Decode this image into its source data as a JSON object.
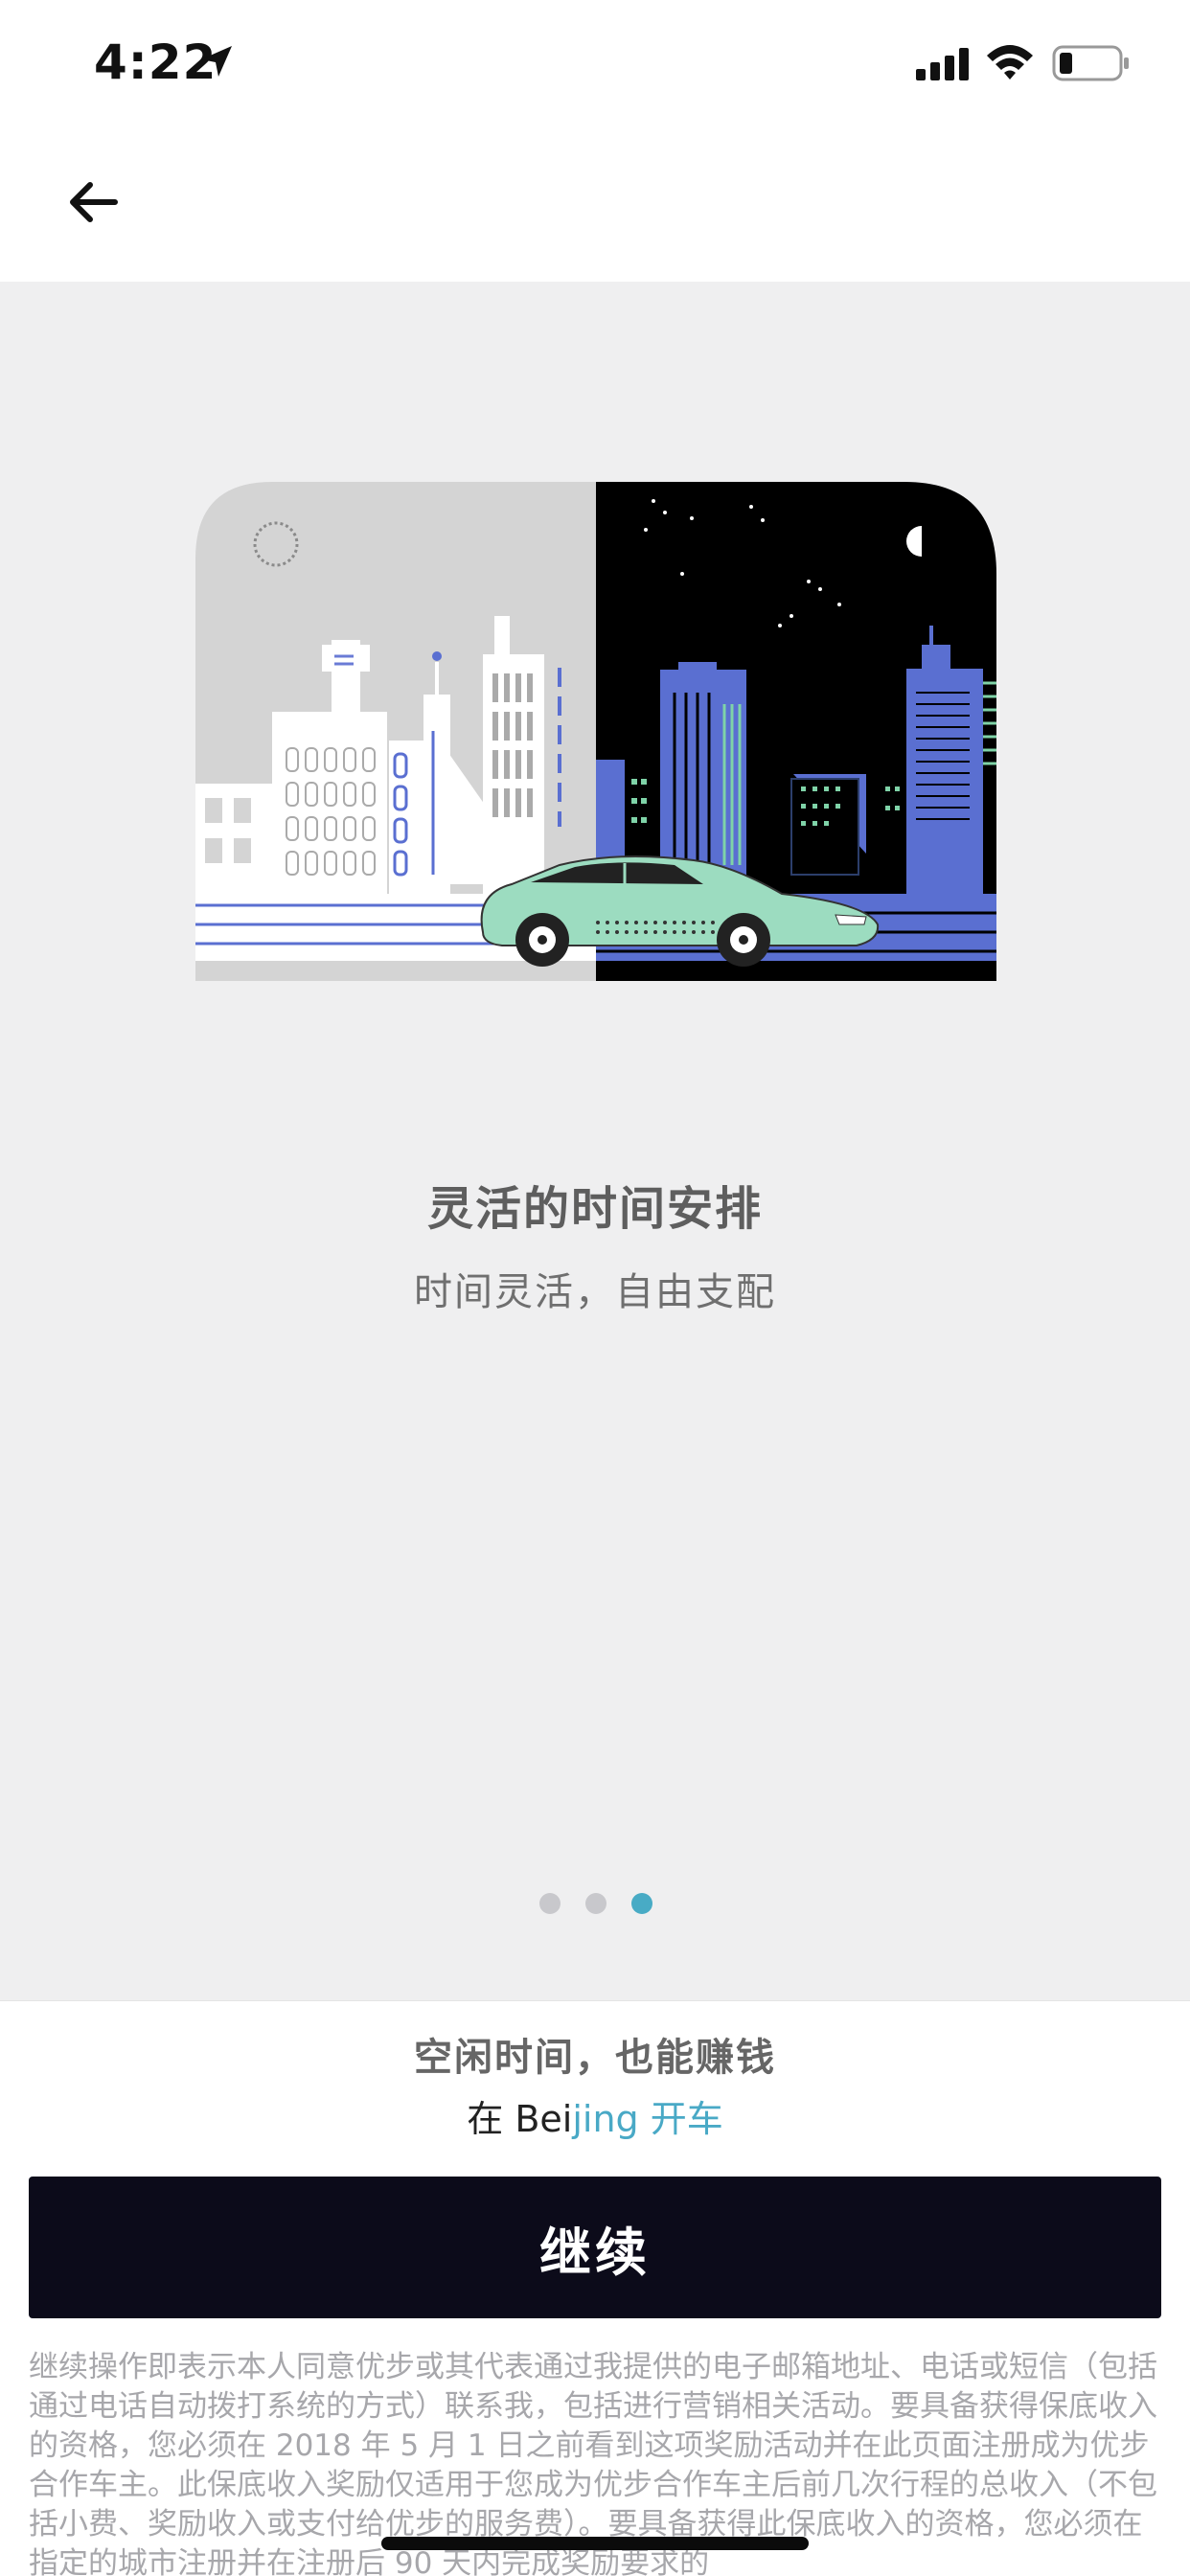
{
  "status_bar": {
    "time": "4:22",
    "icons": [
      "location-arrow-icon",
      "cellular-signal-icon",
      "wifi-icon",
      "battery-low-icon"
    ]
  },
  "nav": {
    "back_icon": "arrow-left-icon"
  },
  "illustration": {
    "subject": "city-day-night-car-illustration",
    "colors": {
      "day_bg": "#d4d4d4",
      "night_bg": "#000000",
      "building_blue": "#5a6fd1",
      "car_mint": "#9cdcc0",
      "accent_green": "#7fd3a8"
    }
  },
  "slide": {
    "title": "灵活的时间安排",
    "subtitle": "时间灵活，自由支配"
  },
  "pagination": {
    "total": 3,
    "active_index": 2,
    "active_color": "#48abc5",
    "inactive_color": "#c8c8cc"
  },
  "bottom": {
    "promo": "空闲时间，也能赚钱",
    "city_prefix": "在 Bei",
    "city_link": "jing 开车",
    "continue_label": "继续",
    "legal_text": "继续操作即表示本人同意优步或其代表通过我提供的电子邮箱地址、电话或短信（包括通过电话自动拨打系统的方式）联系我，包括进行营销相关活动。要具备获得保底收入的资格，您必须在 2018 年 5 月 1 日之前看到这项奖励活动并在此页面注册成为优步合作车主。此保底收入奖励仅适用于您成为优步合作车主后前几次行程的总收入（不包括小费、奖励收入或支付给优步的服务费）。要具备获得此保底收入的资格，您必须在指定的城市注册并在注册后 90 天内完成奖励要求的"
  },
  "colors": {
    "button_bg": "#0c0b1a",
    "link": "#49a9c6",
    "background": "#efeff0"
  }
}
